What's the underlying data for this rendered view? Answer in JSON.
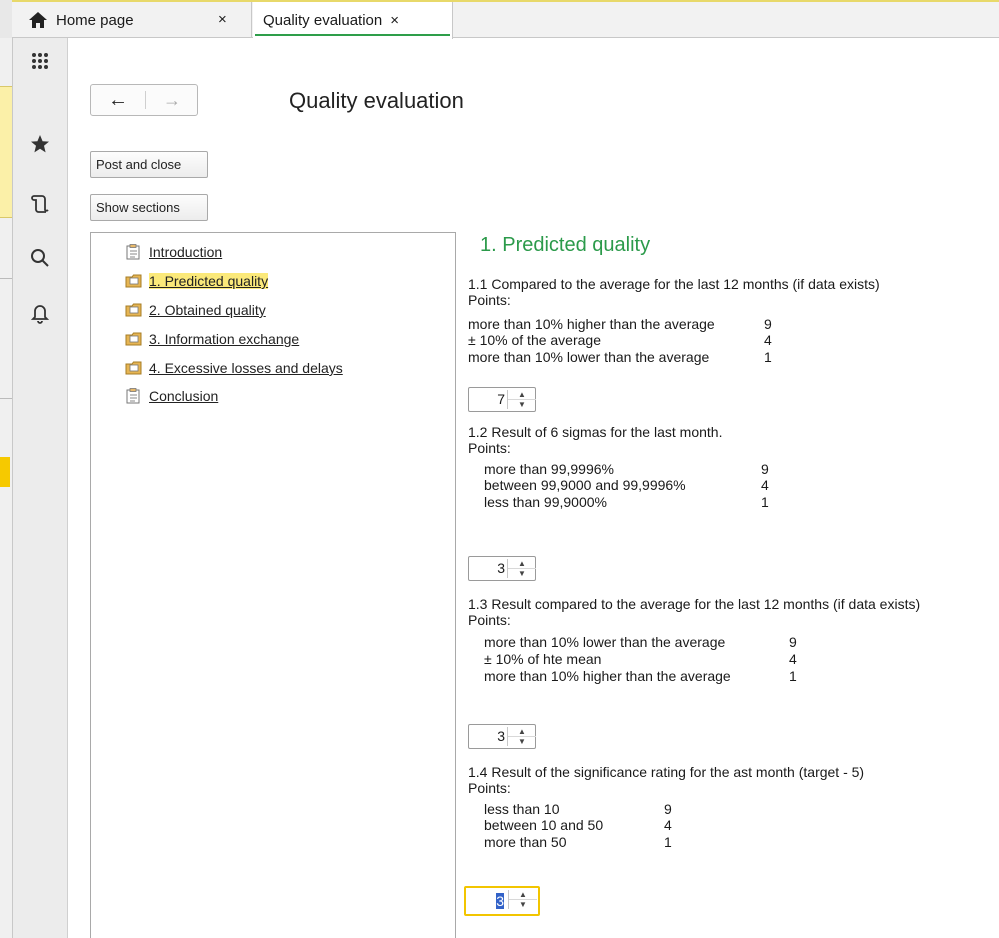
{
  "tabs": {
    "home_label": "Home page",
    "close_glyph": "×",
    "active_label": "Quality evaluation"
  },
  "sidebar": {
    "icons": [
      "apps-grid-icon",
      "star-icon",
      "history-icon",
      "search-icon",
      "bell-icon"
    ]
  },
  "header": {
    "back_glyph": "←",
    "forward_glyph": "→",
    "title": "Quality evaluation"
  },
  "buttons": {
    "post_close": "Post and close",
    "show_sections": "Show sections"
  },
  "tree": {
    "items": [
      {
        "label": "Introduction",
        "icon": "document-icon"
      },
      {
        "label": "1. Predicted quality",
        "icon": "folder-icon"
      },
      {
        "label": "2. Obtained quality",
        "icon": "folder-icon"
      },
      {
        "label": "3. Information exchange",
        "icon": "folder-icon"
      },
      {
        "label": "4. Excessive losses and delays",
        "icon": "folder-icon"
      },
      {
        "label": "Conclusion",
        "icon": "document-icon"
      }
    ],
    "selected_index": 1
  },
  "section": {
    "title": "1. Predicted quality",
    "points_label": "Points:",
    "q1": {
      "heading": "1.1 Compared to the average for the last 12 months (if data exists)",
      "rows": [
        {
          "text": "more than 10% higher than the average",
          "points": "9"
        },
        {
          "text": "± 10% of the average",
          "points": "4"
        },
        {
          "text": "more than 10% lower than the average",
          "points": "1"
        }
      ],
      "value": "7"
    },
    "q2": {
      "heading": "1.2 Result of 6 sigmas for the last month.",
      "rows": [
        {
          "text": "more than 99,9996%",
          "points": "9"
        },
        {
          "text": "between 99,9000 and 99,9996%",
          "points": "4"
        },
        {
          "text": "less than 99,9000%",
          "points": "1"
        }
      ],
      "value": "3"
    },
    "q3": {
      "heading": "1.3 Result compared to the average for the last 12 months (if data exists)",
      "rows": [
        {
          "text": "more than 10% lower than the average",
          "points": "9"
        },
        {
          "text": "± 10% of hte mean",
          "points": "4"
        },
        {
          "text": "more than 10% higher than the average",
          "points": "1"
        }
      ],
      "value": "3"
    },
    "q4": {
      "heading": "1.4 Result of the significance rating for the ast month (target - 5)",
      "rows": [
        {
          "text": "less than 10",
          "points": "9"
        },
        {
          "text": "between 10 and 50",
          "points": "4"
        },
        {
          "text": "more than 50",
          "points": "1"
        }
      ],
      "value": "3"
    }
  },
  "colors": {
    "accent_green": "#2b9a4a",
    "selection_yellow": "#fbe97a",
    "focus_yellow": "#f2c500"
  }
}
